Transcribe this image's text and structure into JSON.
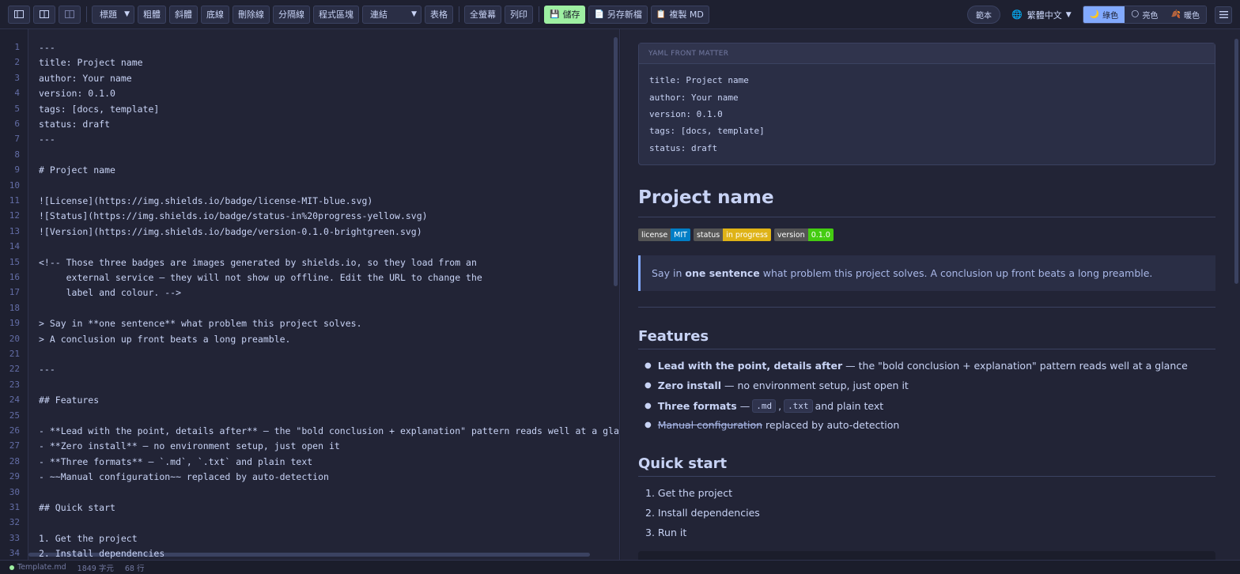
{
  "toolbar": {
    "layout_icons": [
      "panel-left-icon",
      "split-view-icon",
      "panel-right-icon"
    ],
    "heading_select": "標題",
    "bold": "粗體",
    "italic": "斜體",
    "underline": "底線",
    "strikethrough": "刪除線",
    "divider": "分隔線",
    "code_block": "程式區塊",
    "link_select": "連結",
    "table": "表格",
    "fullscreen": "全螢幕",
    "print": "列印",
    "save": "儲存",
    "save_as": "另存新檔",
    "copy_md": "複製 MD",
    "template": "範本",
    "language": "繁體中文",
    "themes": [
      "綠色",
      "亮色",
      "暖色"
    ],
    "colors": {
      "accent": "#82aaff",
      "save": "#9ef0a2"
    }
  },
  "editor": {
    "lines": [
      "---",
      "title: Project name",
      "author: Your name",
      "version: 0.1.0",
      "tags: [docs, template]",
      "status: draft",
      "---",
      "",
      "# Project name",
      "",
      "![License](https://img.shields.io/badge/license-MIT-blue.svg)",
      "![Status](https://img.shields.io/badge/status-in%20progress-yellow.svg)",
      "![Version](https://img.shields.io/badge/version-0.1.0-brightgreen.svg)",
      "",
      "<!-- Those three badges are images generated by shields.io, so they load from an",
      "     external service — they will not show up offline. Edit the URL to change the",
      "     label and colour. -->",
      "",
      "> Say in **one sentence** what problem this project solves.",
      "> A conclusion up front beats a long preamble.",
      "",
      "---",
      "",
      "## Features",
      "",
      "- **Lead with the point, details after** — the \"bold conclusion + explanation\" pattern reads well at a gla",
      "- **Zero install** — no environment setup, just open it",
      "- **Three formats** — `.md`, `.txt` and plain text",
      "- ~~Manual configuration~~ replaced by auto-detection",
      "",
      "## Quick start",
      "",
      "1. Get the project",
      "2. Install dependencies"
    ]
  },
  "preview": {
    "front_matter_title": "YAML FRONT MATTER",
    "front_matter": [
      "title: Project name",
      "author: Your name",
      "version: 0.1.0",
      "tags: [docs, template]",
      "status: draft"
    ],
    "h1": "Project name",
    "badges": [
      {
        "key": "license",
        "value": "MIT",
        "color": "#007ec6"
      },
      {
        "key": "status",
        "value": "in progress",
        "color": "#dfb317"
      },
      {
        "key": "version",
        "value": "0.1.0",
        "color": "#4c1"
      }
    ],
    "quote": {
      "before": "Say in",
      "bold": "one sentence",
      "after": "what problem this project solves. A conclusion up front beats a long preamble."
    },
    "features_heading": "Features",
    "features": [
      {
        "bold": "Lead with the point, details after",
        "rest": "— the \"bold conclusion + explanation\" pattern reads well at a glance"
      },
      {
        "bold": "Zero install",
        "rest": "— no environment setup, just open it"
      }
    ],
    "formats": {
      "bold": "Three formats",
      "dash": "—",
      "code1": ".md",
      "comma": ",",
      "code2": ".txt",
      "rest": "and plain text"
    },
    "manual": {
      "strike": "Manual configuration",
      "rest": "replaced by auto-detection"
    },
    "quick_heading": "Quick start",
    "steps": [
      "1. Get the project",
      "2. Install dependencies",
      "3. Run it"
    ]
  },
  "status": {
    "file": "Template.md",
    "chars": "1849 字元",
    "lines": "68 行"
  }
}
